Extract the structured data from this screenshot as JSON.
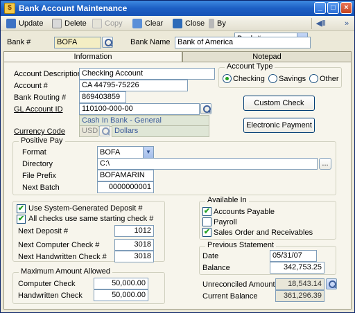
{
  "window": {
    "title": "Bank Account Maintenance"
  },
  "toolbar": {
    "update": "Update",
    "delete": "Delete",
    "copy": "Copy",
    "clear": "Clear",
    "close": "Close",
    "by": "By",
    "by_value": "Bank #"
  },
  "header": {
    "bank_num_label": "Bank #",
    "bank_num": "BOFA",
    "bank_name_label": "Bank Name",
    "bank_name": "Bank of America"
  },
  "tabs": [
    {
      "label": "Information"
    },
    {
      "label": "Notepad"
    }
  ],
  "info": {
    "account_description_label": "Account Description",
    "account_description": "Checking Account",
    "account_num_label": "Account #",
    "account_num": "CA 44795-75226",
    "routing_label": "Bank Routing #",
    "routing": "869403859",
    "gl_label": "GL Account ID",
    "gl": "110100-000-00",
    "gl_desc": "Cash In Bank - General",
    "currency_label": "Currency Code",
    "currency": "USD",
    "currency_desc": "Dollars"
  },
  "account_type": {
    "title": "Account Type",
    "options": [
      "Checking",
      "Savings",
      "Other"
    ],
    "selected": "Checking"
  },
  "buttons": {
    "custom_check": "Custom Check",
    "electronic_payment": "Electronic Payment"
  },
  "positive_pay": {
    "title": "Positive Pay",
    "format_label": "Format",
    "format": "BOFA",
    "directory_label": "Directory",
    "directory": "C:\\",
    "browse": "...",
    "prefix_label": "File Prefix",
    "prefix": "BOFAMARIN",
    "next_batch_label": "Next Batch",
    "next_batch": "0000000001"
  },
  "deposit": {
    "use_system_label": "Use System-Generated Deposit #",
    "same_start_label": "All checks use same starting check #",
    "next_deposit_label": "Next Deposit #",
    "next_deposit": "1012",
    "next_computer_label": "Next Computer Check #",
    "next_computer": "3018",
    "next_handwritten_label": "Next Handwritten Check #",
    "next_handwritten": "3018"
  },
  "available_in": {
    "title": "Available In",
    "items": [
      {
        "label": "Accounts Payable",
        "checked": true
      },
      {
        "label": "Payroll",
        "checked": false
      },
      {
        "label": "Sales Order and Receivables",
        "checked": true
      }
    ]
  },
  "previous_statement": {
    "title": "Previous Statement",
    "date_label": "Date",
    "date": "05/31/07",
    "balance_label": "Balance",
    "balance": "342,753.25"
  },
  "max_amount": {
    "title": "Maximum Amount Allowed",
    "computer_label": "Computer Check",
    "computer": "50,000.00",
    "handwritten_label": "Handwritten Check",
    "handwritten": "50,000.00"
  },
  "totals": {
    "unreconciled_label": "Unreconciled Amount",
    "unreconciled": "18,543.14",
    "current_label": "Current Balance",
    "current": "361,296.39"
  },
  "colors": {
    "titlebar": "#1d5fc4",
    "checkmark": "#21a121",
    "field_border": "#7f9db9"
  }
}
